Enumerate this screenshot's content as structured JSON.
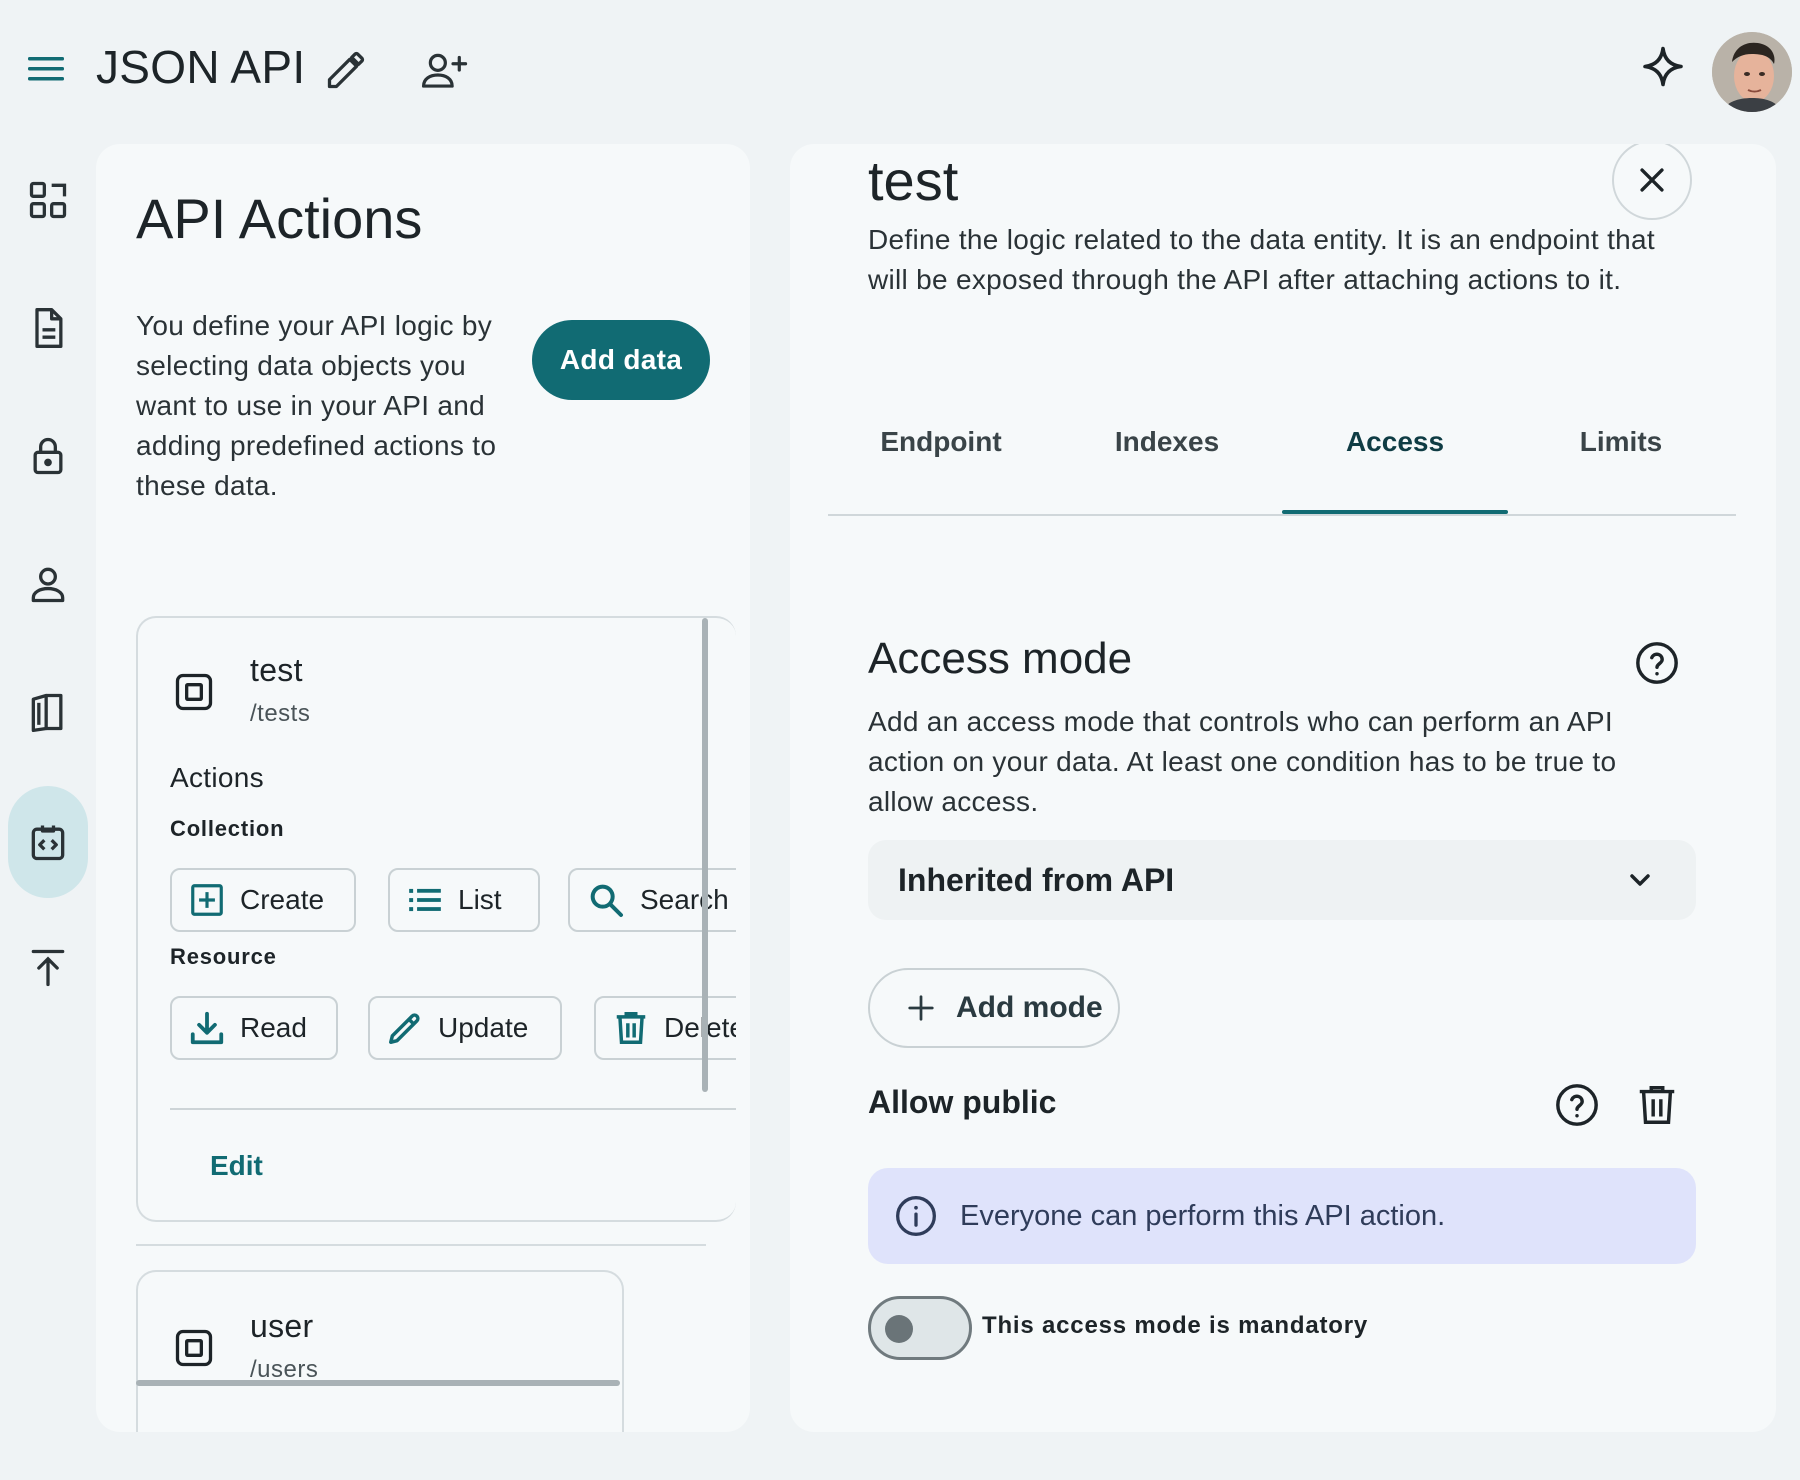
{
  "header": {
    "app_title": "JSON API",
    "icons": [
      "menu-icon",
      "pencil-icon",
      "add-person-icon",
      "sparkle-icon",
      "avatar"
    ]
  },
  "rail": {
    "items": [
      "dashboard-icon",
      "document-icon",
      "lock-icon",
      "person-icon",
      "book-icon",
      "api-icon",
      "upload-icon"
    ],
    "active_index": 5
  },
  "left_panel": {
    "title": "API Actions",
    "description_lines": [
      "You define your API logic by",
      "selecting data objects you",
      "want to use in your API and",
      "adding predefined actions to",
      "these data."
    ],
    "add_button": "Add data",
    "entities": [
      {
        "name": "test",
        "path": "/tests",
        "actions_label": "Actions",
        "collection_label": "Collection",
        "collection_actions": [
          "Create",
          "List",
          "Search"
        ],
        "resource_label": "Resource",
        "resource_actions": [
          "Read",
          "Update",
          "Delete"
        ],
        "edit_label": "Edit"
      },
      {
        "name": "user",
        "path": "/users"
      }
    ]
  },
  "right_panel": {
    "title": "test",
    "description_lines": [
      "Define the logic related to the data entity. It is an endpoint that",
      "will be exposed through the API after attaching actions to it."
    ],
    "tabs": [
      "Endpoint",
      "Indexes",
      "Access",
      "Limits"
    ],
    "active_tab": "Access",
    "access": {
      "title": "Access mode",
      "description_lines": [
        "Add an access mode that controls who can perform an API",
        "action on your data. At least one condition has to be true to",
        "allow access."
      ],
      "select_value": "Inherited from API",
      "add_mode_label": "Add mode",
      "mode_name": "Allow public",
      "info_text": "Everyone can perform this API action.",
      "mandatory_label": "This access mode is mandatory",
      "mandatory": false
    }
  },
  "colors": {
    "accent": "#116b73",
    "background": "#eff3f5",
    "panel": "#f6f9fa",
    "info_bg": "#dfe3fb",
    "rail_active": "#cfe6ea"
  }
}
